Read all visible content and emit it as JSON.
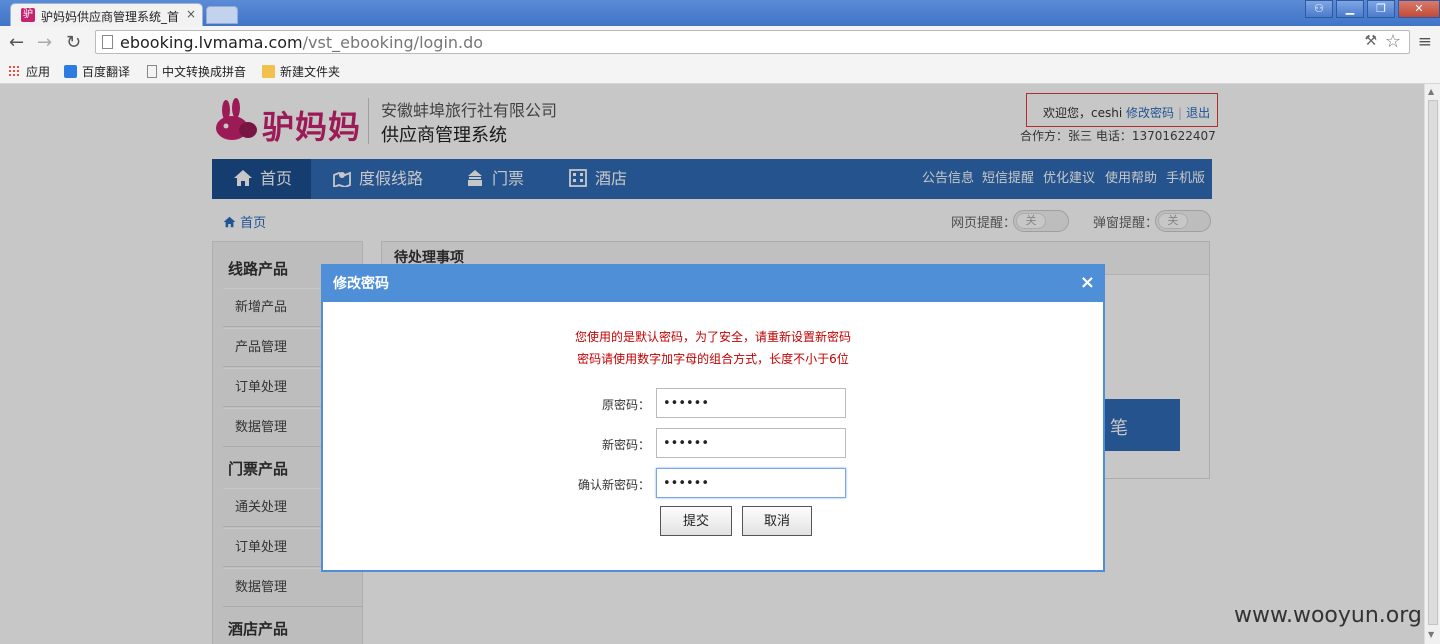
{
  "browser": {
    "tab_title": "驴妈妈供应商管理系统_首",
    "tab_close": "×",
    "url_host": "ebooking.lvmama.com",
    "url_path": "/vst_ebooking/login.do",
    "bookmarks": [
      "应用",
      "百度翻译",
      "中文转换成拼音",
      "新建文件夹"
    ],
    "bookmark_icons": [
      "apps-icon",
      "translate-icon",
      "page-icon",
      "folder-icon"
    ]
  },
  "header": {
    "logo_text": "驴妈妈",
    "company": "安徽蚌埠旅行社有限公司",
    "system": "供应商管理系统",
    "welcome_prefix": "欢迎您，ceshi",
    "change_password": "修改密码",
    "separator": "|",
    "logout": "退出",
    "partner_info": "合作方：张三 电话：13701622407"
  },
  "nav": {
    "items": [
      {
        "label": "首页",
        "icon": "home-icon"
      },
      {
        "label": "度假线路",
        "icon": "map-icon"
      },
      {
        "label": "门票",
        "icon": "ticket-icon"
      },
      {
        "label": "酒店",
        "icon": "hotel-icon"
      }
    ],
    "links": [
      "公告信息",
      "短信提醒",
      "优化建议",
      "使用帮助",
      "手机版"
    ]
  },
  "subbar": {
    "breadcrumb": "首页",
    "web_alert_label": "网页提醒：",
    "popup_alert_label": "弹窗提醒：",
    "toggle_off": "关"
  },
  "sidebar": {
    "sections": [
      {
        "title": "线路产品",
        "items": [
          "新增产品",
          "产品管理",
          "订单处理",
          "数据管理"
        ]
      },
      {
        "title": "门票产品",
        "items": [
          "通关处理",
          "订单处理",
          "数据管理"
        ]
      },
      {
        "title": "酒店产品",
        "items": []
      }
    ]
  },
  "panel": {
    "title": "待处理事项",
    "box_text": "笔"
  },
  "modal": {
    "title": "修改密码",
    "close": "×",
    "warning_line1": "您使用的是默认密码，为了安全，请重新设置新密码",
    "warning_line2": "密码请使用数字加字母的组合方式，长度不小于6位",
    "fields": [
      {
        "label": "原密码：",
        "value": "••••••"
      },
      {
        "label": "新密码：",
        "value": "••••••"
      },
      {
        "label": "确认新密码：",
        "value": "••••••"
      }
    ],
    "submit": "提交",
    "cancel": "取消"
  },
  "watermark": "www.wooyun.org",
  "colors": {
    "brand": "#c8236f",
    "nav_blue": "#2f6bb5",
    "modal_blue": "#4f8fd8",
    "warning_red": "#c40000"
  }
}
